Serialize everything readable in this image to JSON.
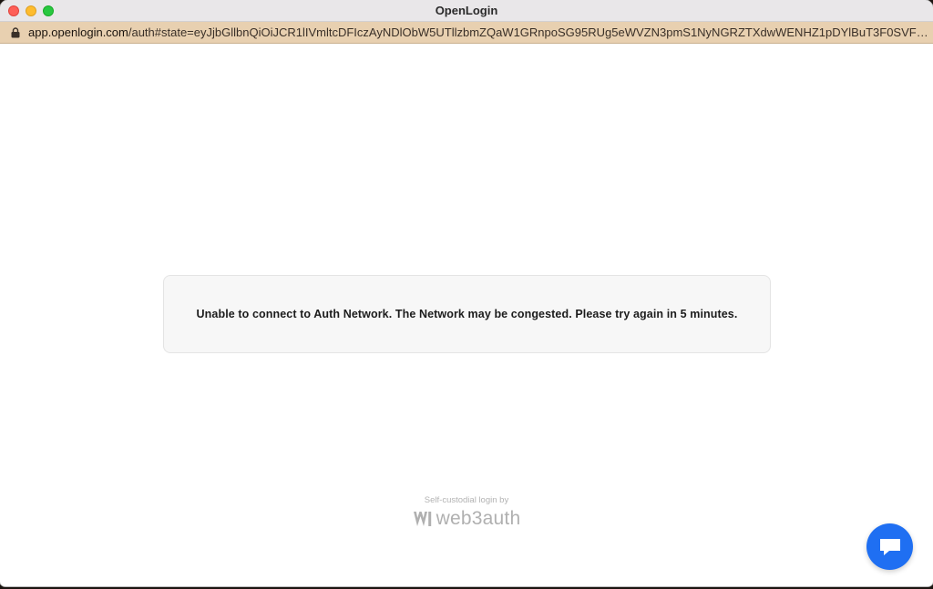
{
  "window": {
    "title": "OpenLogin"
  },
  "address_bar": {
    "host": "app.openlogin.com",
    "path": "/auth#state=eyJjbGllbnQiOiJCR1lIVmltcDFIczAyNDlObW5UTllzbmZQaW1GRnpoSG95RUg5eWVZN3pmS1NyNGRZTXdwWENHZ1pDYlBuT3F0SVFKeHVOd..."
  },
  "error": {
    "message": "Unable to connect to Auth Network. The Network may be congested. Please try again in 5 minutes."
  },
  "footer": {
    "caption": "Self-custodial login by",
    "brand": "web3auth"
  },
  "icons": {
    "lock": "lock-icon",
    "chat": "chat-icon",
    "logo": "web3auth-logo-icon"
  },
  "colors": {
    "chat_button": "#1f6ff2",
    "url_bar": "#e8d0b0"
  }
}
